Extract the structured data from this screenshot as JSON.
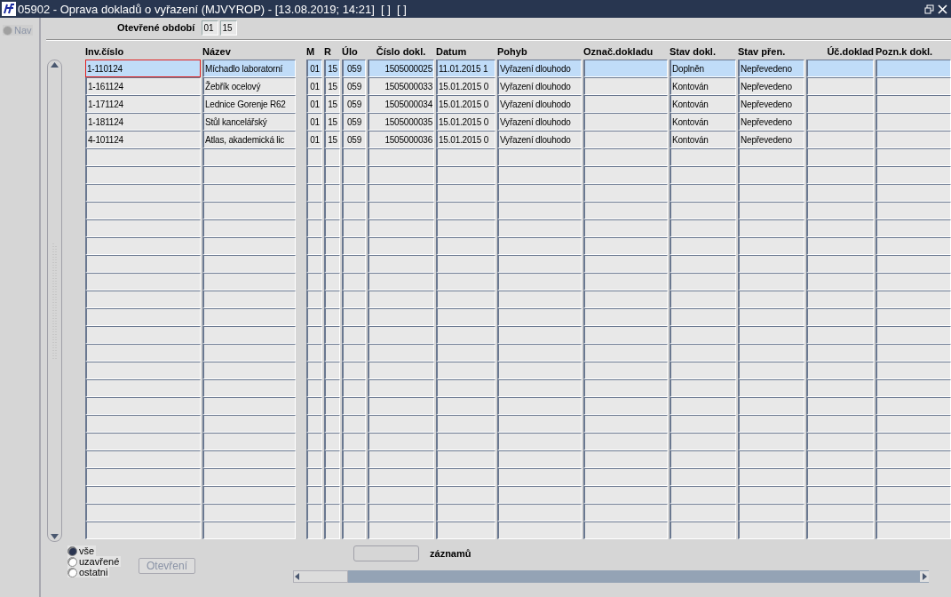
{
  "window": {
    "title": "05902 - Oprava dokladů o vyřazení (MJVYROP) - [13.08.2019; 14:21]  [ ]  [ ]"
  },
  "sidebar": {
    "nav": {
      "label": "Nav",
      "disabled": true
    }
  },
  "period": {
    "label": "Otevřené období",
    "fields": [
      "01",
      "15"
    ]
  },
  "table": {
    "columns": [
      "Inv.číslo",
      "Název",
      "M",
      "R",
      "Úlo",
      "Číslo dokl.",
      "Datum",
      "Pohyb",
      "Označ.dokladu",
      "Stav dokl.",
      "Stav přen.",
      "Úč.doklad",
      "Pozn.k dokl."
    ],
    "rows": [
      {
        "selected": true,
        "cells": [
          "1-110124",
          "Míchadlo laboratorní",
          "01",
          "15",
          "059",
          "1505000025",
          "11.01.2015 1",
          "Vyřazení dlouhodo",
          null,
          "Doplněn",
          "Nepřevedeno",
          null,
          null
        ]
      },
      {
        "selected": false,
        "cells": [
          "1-161124",
          "Žebřík ocelový",
          "01",
          "15",
          "059",
          "1505000033",
          "15.01.2015 0",
          "Vyřazení dlouhodo",
          null,
          "Kontován",
          "Nepřevedeno",
          null,
          null
        ]
      },
      {
        "selected": false,
        "cells": [
          "1-171124",
          "Lednice Gorenje R62",
          "01",
          "15",
          "059",
          "1505000034",
          "15.01.2015 0",
          "Vyřazení dlouhodo",
          null,
          "Kontován",
          "Nepřevedeno",
          null,
          null
        ]
      },
      {
        "selected": false,
        "cells": [
          "1-181124",
          "Stůl kancelářský",
          "01",
          "15",
          "059",
          "1505000035",
          "15.01.2015 0",
          "Vyřazení dlouhodo",
          null,
          "Kontován",
          "Nepřevedeno",
          null,
          null
        ]
      },
      {
        "selected": false,
        "cells": [
          "4-101124",
          "Atlas, akademická lic",
          "01",
          "15",
          "059",
          "1505000036",
          "15.01.2015 0",
          "Vyřazení dlouhodo",
          null,
          "Kontován",
          "Nepřevedeno",
          null,
          null
        ]
      }
    ]
  },
  "filter": [
    {
      "label": "vše",
      "selected": true
    },
    {
      "label": "uzavřené",
      "selected": false
    },
    {
      "label": "ostatni",
      "selected": false
    }
  ],
  "open_button": {
    "label": "Otevření",
    "disabled": true
  },
  "records_label": "záznamů"
}
